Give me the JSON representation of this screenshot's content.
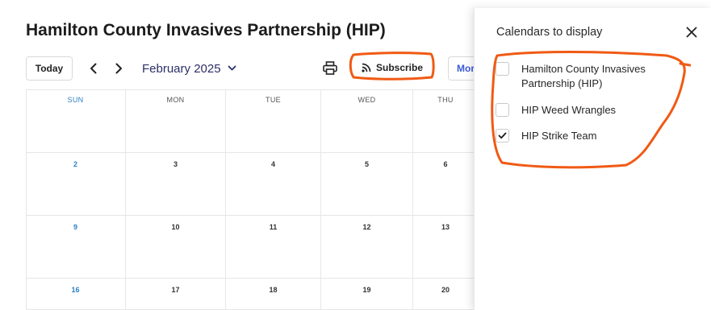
{
  "page": {
    "title": "Hamilton County Invasives Partnership (HIP)"
  },
  "toolbar": {
    "today_label": "Today",
    "month_label": "February 2025",
    "subscribe_label": "Subscribe",
    "more_label": "Mor"
  },
  "calendar": {
    "weekdays": [
      "SUN",
      "MON",
      "TUE",
      "WED",
      "THU"
    ],
    "weeks": [
      [
        "",
        "",
        "",
        "",
        ""
      ],
      [
        "2",
        "3",
        "4",
        "5",
        "6"
      ],
      [
        "9",
        "10",
        "11",
        "12",
        "13"
      ],
      [
        "16",
        "17",
        "18",
        "19",
        "20"
      ]
    ]
  },
  "panel": {
    "title": "Calendars to display",
    "calendars": [
      {
        "label": "Hamilton County Invasives Partnership (HIP)",
        "checked": false
      },
      {
        "label": "HIP Weed Wrangles",
        "checked": false
      },
      {
        "label": "HIP Strike Team",
        "checked": true
      }
    ]
  },
  "colors": {
    "annotation": "#f05a14",
    "sunday": "#2f7fc4",
    "month_text": "#2a2f66",
    "more_text": "#3b5bd6"
  },
  "icons": {
    "prev": "chevron-left-icon",
    "next": "chevron-right-icon",
    "dropdown": "chevron-down-icon",
    "print": "printer-icon",
    "subscribe": "rss-icon",
    "close": "close-icon",
    "check": "checkmark-icon"
  }
}
